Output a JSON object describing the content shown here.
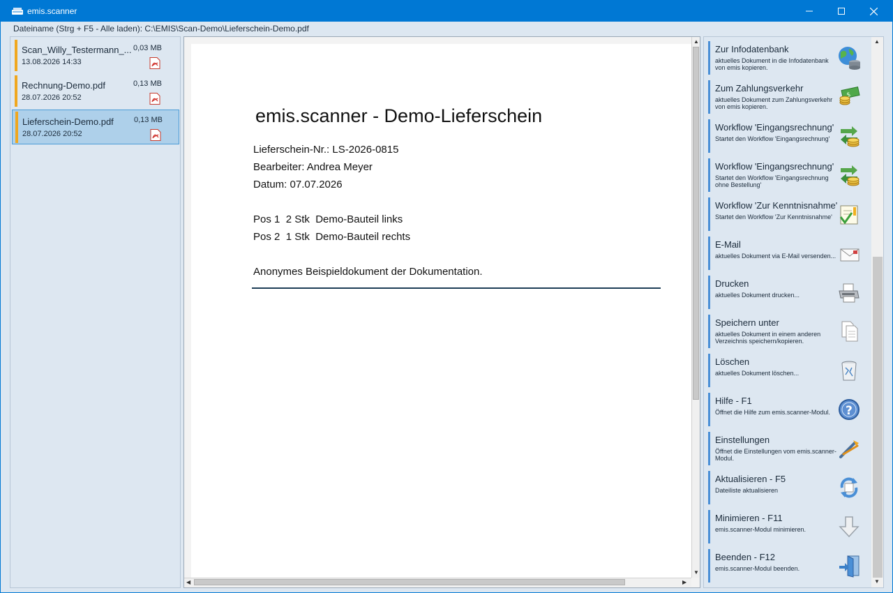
{
  "window": {
    "title": "emis.scanner",
    "controls": {
      "minimize": "–",
      "maximize": "☐",
      "close": "✕"
    }
  },
  "filename_bar": "Dateiname (Strg + F5 - Alle laden): C:\\EMIS\\Scan-Demo\\Lieferschein-Demo.pdf",
  "files": [
    {
      "name": "Scan_Willy_Testermann_...",
      "date": "13.08.2026 14:33",
      "size": "0,03 MB",
      "selected": false
    },
    {
      "name": "Rechnung-Demo.pdf",
      "date": "28.07.2026 20:52",
      "size": "0,13 MB",
      "selected": false
    },
    {
      "name": "Lieferschein-Demo.pdf",
      "date": "28.07.2026 20:52",
      "size": "0,13 MB",
      "selected": true
    }
  ],
  "document": {
    "title": "emis.scanner - Demo-Lieferschein",
    "lines": [
      "Lieferschein-Nr.: LS-2026-0815",
      "Bearbeiter: Andrea Meyer",
      "Datum: 07.07.2026",
      "Pos 1  2 Stk  Demo-Bauteil links",
      "Pos 2  1 Stk  Demo-Bauteil rechts",
      "Anonymes Beispieldokument der Dokumentation."
    ]
  },
  "actions": [
    {
      "title": "Zur Infodatenbank",
      "desc": "aktuelles Dokument in die Infodatenbank von emis kopieren.",
      "icon": "database-globe-icon"
    },
    {
      "title": "Zum Zahlungsverkehr",
      "desc": "aktuelles Dokument zum Zahlungsverkehr von emis kopieren.",
      "icon": "money-icon"
    },
    {
      "title": "Workflow 'Eingangsrechnung'",
      "desc": "Startet den Workflow 'Eingangsrechnung'",
      "icon": "workflow-coins-icon"
    },
    {
      "title": "Workflow 'Eingangsrechnung'",
      "desc": "Startet den Workflow 'Eingangsrechnung ohne Bestellung'",
      "icon": "workflow-coins-icon"
    },
    {
      "title": "Workflow 'Zur Kenntnisnahme'",
      "desc": "Startet den Workflow 'Zur Kenntnisnahme'",
      "icon": "checklist-icon"
    },
    {
      "title": "E-Mail",
      "desc": "aktuelles Dokument via E-Mail versenden...",
      "icon": "envelope-icon"
    },
    {
      "title": "Drucken",
      "desc": "aktuelles Dokument drucken...",
      "icon": "printer-icon"
    },
    {
      "title": "Speichern unter",
      "desc": "aktuelles Dokument in einem anderen Verzeichnis speichern/kopieren.",
      "icon": "documents-icon"
    },
    {
      "title": "Löschen",
      "desc": "aktuelles Dokument löschen...",
      "icon": "trash-icon"
    },
    {
      "title": "Hilfe - F1",
      "desc": "Öffnet die Hilfe zum emis.scanner-Modul.",
      "icon": "help-icon"
    },
    {
      "title": "Einstellungen",
      "desc": "Öffnet die Einstellungen vom emis.scanner-Modul.",
      "icon": "tools-icon"
    },
    {
      "title": "Aktualisieren - F5",
      "desc": "Dateiliste aktualisieren",
      "icon": "refresh-icon"
    },
    {
      "title": "Minimieren - F11",
      "desc": "emis.scanner-Modul minimieren.",
      "icon": "arrow-down-icon"
    },
    {
      "title": "Beenden - F12",
      "desc": "emis.scanner-Modul beenden.",
      "icon": "exit-door-icon"
    }
  ]
}
